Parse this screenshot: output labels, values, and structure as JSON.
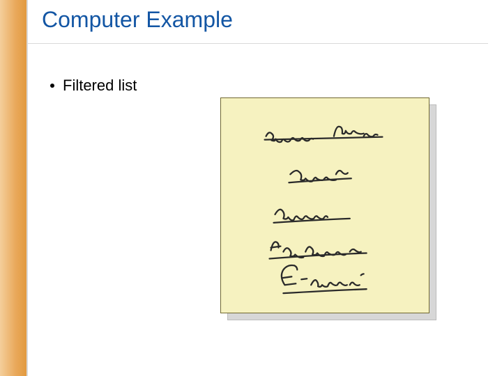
{
  "title": "Computer Example",
  "bullet": {
    "text": "Filtered list"
  },
  "note": {
    "line1": "address list",
    "line2": "name",
    "line3": "address",
    "line4": "telephone",
    "line5": "E-mail"
  },
  "colors": {
    "accent_gradient_start": "#f4cf9b",
    "accent_gradient_end": "#e29a3f",
    "title_color": "#1356a4",
    "note_bg": "#f6f2c0",
    "note_border": "#6f672f"
  }
}
